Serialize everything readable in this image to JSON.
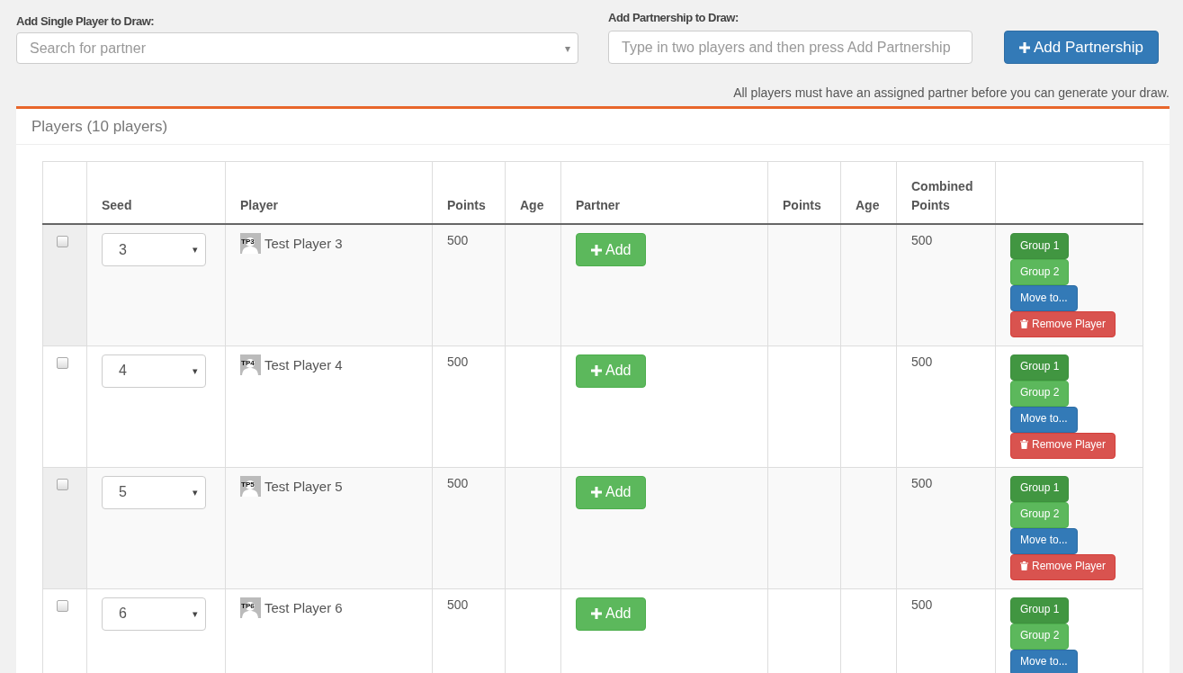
{
  "single_player": {
    "label": "Add Single Player to Draw:",
    "placeholder": "Search for partner",
    "arrow": "▾"
  },
  "partnership": {
    "label": "Add Partnership to Draw:",
    "placeholder": "Type in two players and then press Add Partnership",
    "button": "Add Partnership"
  },
  "notice": "All players must have an assigned partner before you can generate your draw.",
  "panel": {
    "title": "Players (10 players)"
  },
  "table": {
    "columns": [
      "",
      "Seed",
      "Player",
      "Points",
      "Age",
      "Partner",
      "Points",
      "Age",
      "Combined Points",
      ""
    ],
    "rows": [
      {
        "checked": false,
        "seed": "3",
        "initials": "TP3",
        "player": "Test Player 3",
        "points": "500",
        "partner_button": "Add",
        "combined": "500",
        "actions": [
          {
            "kind": "group",
            "label": "Group 1",
            "selected": true
          },
          {
            "kind": "group",
            "label": "Group 2",
            "selected": false
          },
          {
            "kind": "move",
            "label": "Move to..."
          },
          {
            "kind": "remove",
            "label": "Remove Player"
          }
        ]
      },
      {
        "checked": false,
        "seed": "4",
        "initials": "TP4",
        "player": "Test Player 4",
        "points": "500",
        "partner_button": "Add",
        "combined": "500",
        "actions": [
          {
            "kind": "group",
            "label": "Group 1",
            "selected": true
          },
          {
            "kind": "group",
            "label": "Group 2",
            "selected": false
          },
          {
            "kind": "move",
            "label": "Move to..."
          },
          {
            "kind": "remove",
            "label": "Remove Player"
          }
        ]
      },
      {
        "checked": false,
        "seed": "5",
        "initials": "TP5",
        "player": "Test Player 5",
        "points": "500",
        "partner_button": "Add",
        "combined": "500",
        "actions": [
          {
            "kind": "group",
            "label": "Group 1",
            "selected": true
          },
          {
            "kind": "group",
            "label": "Group 2",
            "selected": false
          },
          {
            "kind": "move",
            "label": "Move to..."
          },
          {
            "kind": "remove",
            "label": "Remove Player"
          }
        ]
      },
      {
        "checked": false,
        "seed": "6",
        "initials": "TP6",
        "player": "Test Player 6",
        "points": "500",
        "partner_button": "Add",
        "combined": "500",
        "actions": [
          {
            "kind": "group",
            "label": "Group 1",
            "selected": true
          },
          {
            "kind": "group",
            "label": "Group 2",
            "selected": false
          },
          {
            "kind": "move",
            "label": "Move to..."
          }
        ]
      }
    ]
  }
}
